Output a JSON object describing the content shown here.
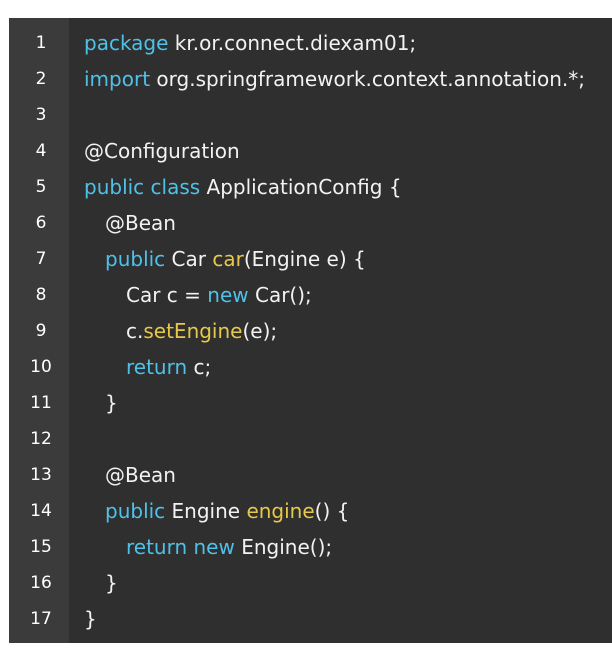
{
  "colors": {
    "background": "#2f2f2f",
    "gutter": "#3b3b3b",
    "keyword": "#4fc1e9",
    "method": "#e6c84a",
    "text": "#f2f2f2"
  },
  "line_numbers": [
    "1",
    "2",
    "3",
    "4",
    "5",
    "6",
    "7",
    "8",
    "9",
    "10",
    "11",
    "12",
    "13",
    "14",
    "15",
    "16",
    "17"
  ],
  "code": {
    "l1": {
      "kw": "package",
      "rest": " kr.or.connect.diexam01;"
    },
    "l2": {
      "kw": "import",
      "rest": " org.springframework.context.annotation.*;"
    },
    "l4": {
      "text": "@Configuration"
    },
    "l5": {
      "kw": "public class",
      "rest": " ApplicationConfig {"
    },
    "l6": {
      "text": "@Bean"
    },
    "l7": {
      "kw": "public",
      "mid": " Car ",
      "fn": "car",
      "rest": "(Engine e) {"
    },
    "l8": {
      "pre": "Car c = ",
      "kw": "new",
      "rest": " Car();"
    },
    "l9": {
      "pre": "c.",
      "fn": "setEngine",
      "rest": "(e);"
    },
    "l10": {
      "kw": "return",
      "rest": " c;"
    },
    "l11": {
      "text": "}"
    },
    "l13": {
      "text": "@Bean"
    },
    "l14": {
      "kw": "public",
      "mid": " Engine ",
      "fn": "engine",
      "rest": "() {"
    },
    "l15": {
      "kw": "return new",
      "rest": " Engine();"
    },
    "l16": {
      "text": "}"
    },
    "l17": {
      "text": "}"
    }
  }
}
